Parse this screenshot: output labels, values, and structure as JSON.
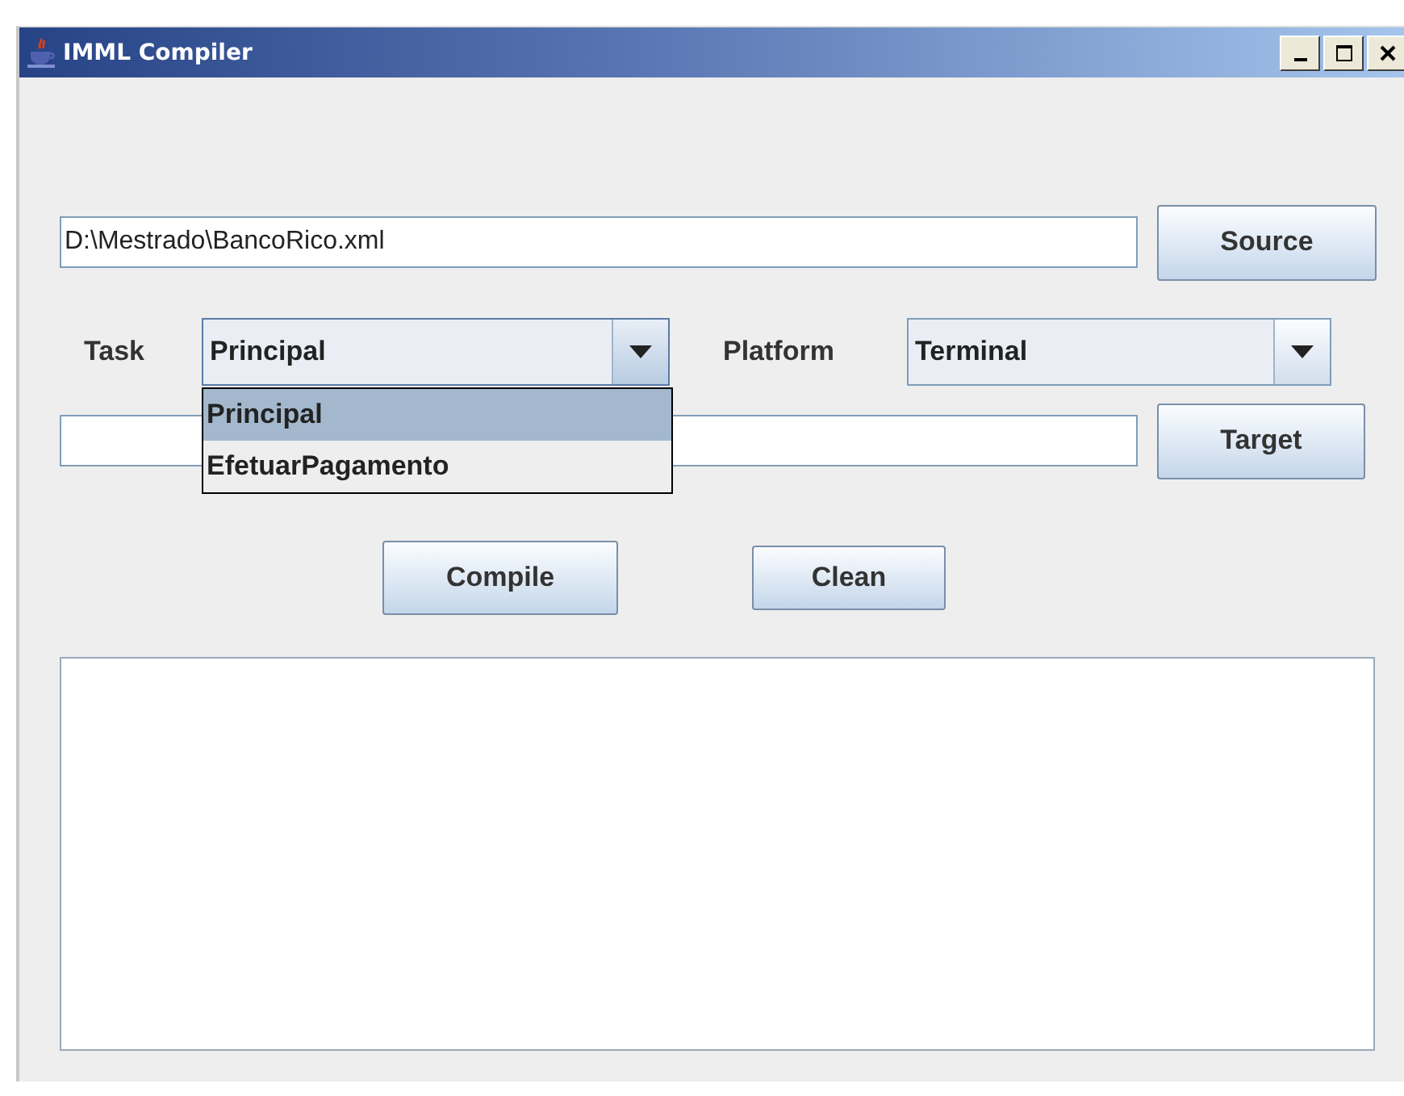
{
  "window": {
    "title": "IMML Compiler"
  },
  "source": {
    "value": "D:\\Mestrado\\BancoRico.xml",
    "button": "Source"
  },
  "task": {
    "label": "Task",
    "value": "Principal",
    "expanded": true,
    "options": [
      {
        "label": "Principal",
        "selected": true
      },
      {
        "label": "EfetuarPagamento",
        "selected": false
      }
    ]
  },
  "platform": {
    "label": "Platform",
    "value": "Terminal"
  },
  "target": {
    "button": "Target"
  },
  "buttons": [
    "Compile",
    "Clean"
  ]
}
